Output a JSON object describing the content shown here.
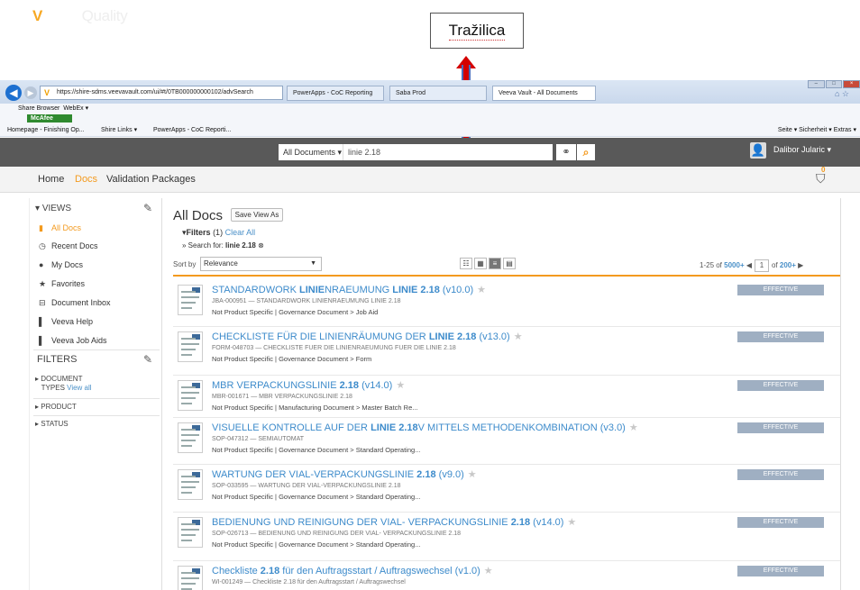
{
  "annotation": {
    "label": "Tražilica"
  },
  "browser": {
    "address": "https://shire-sdms.veevavault.com/ui/#t/0TB000000000102/advSearch",
    "tabs": [
      "PowerApps - CoC Reporting",
      "Saba Prod",
      "Veeva Vault - All Documents"
    ],
    "toolbar": {
      "share": "Share Browser",
      "webex": "WebEx ▾",
      "mcafee": "McAfee"
    },
    "favorites": [
      "Homepage - Finishing Op...",
      "Shire Links ▾",
      "PowerApps - CoC Reporti..."
    ],
    "commands": "Seite ▾  Sicherheit ▾  Extras ▾"
  },
  "header": {
    "logo_brand": "Vault",
    "logo_product": "Quality",
    "doc_selector": "All Documents ▾",
    "search_value": "linie 2.18",
    "user": "Dalibor Jularic ▾"
  },
  "nav": {
    "home": "Home",
    "docs": "Docs",
    "validation": "Validation Packages",
    "cart_count": "0"
  },
  "sidebar": {
    "views_title": "VIEWS",
    "views": [
      {
        "label": "All Docs",
        "icon": "doc-icon"
      },
      {
        "label": "Recent Docs",
        "icon": "clock-icon"
      },
      {
        "label": "My Docs",
        "icon": "user-icon"
      },
      {
        "label": "Favorites",
        "icon": "star-icon"
      },
      {
        "label": "Document Inbox",
        "icon": "inbox-icon"
      },
      {
        "label": "Veeva Help",
        "icon": "bookmark-icon"
      },
      {
        "label": "Veeva Job Aids",
        "icon": "bookmark-icon"
      }
    ],
    "filters_title": "FILTERS",
    "doc_types_1": "DOCUMENT",
    "doc_types_2": "TYPES",
    "view_all": "View all",
    "product": "PRODUCT",
    "status": "STATUS"
  },
  "main": {
    "title": "All Docs",
    "save_view": "Save View As",
    "filters_label": "Filters",
    "filters_count": "(1)",
    "clear_all": "Clear All",
    "search_for_label": "Search for:",
    "search_for_value": "linie 2.18",
    "sort_label": "Sort by",
    "sort_value": "Relevance",
    "pager_range": "1-25 of",
    "pager_total": "5000+",
    "page": "1",
    "page_of": "of",
    "page_total": "200+"
  },
  "docs": [
    {
      "title_pre": "STANDARDWORK ",
      "title_b1": "LINIE",
      "title_mid": "NRAEUMUNG ",
      "title_b2": "LINIE 2.18",
      "title_post": " (v10.0)",
      "sub": "JBA-000951 — STANDARDWORK LINIENRAEUMUNG LINIE 2.18",
      "cat": "Not Product Specific  |  Governance Document > Job Aid",
      "status": "EFFECTIVE"
    },
    {
      "title_pre": "CHECKLISTE FÜR DIE LINIENRÄUMUNG DER ",
      "title_b1": "LINIE 2.18",
      "title_mid": "",
      "title_b2": "",
      "title_post": " (v13.0)",
      "sub": "FORM-048703 — CHECKLISTE FUER DIE LINIENRAEUMUNG FUER DIE LINIE 2.18",
      "cat": "Not Product Specific  |  Governance Document > Form",
      "status": "EFFECTIVE"
    },
    {
      "title_pre": "MBR VERPACKUNGSLINIE ",
      "title_b1": "2.18",
      "title_mid": "",
      "title_b2": "",
      "title_post": " (v14.0)",
      "sub": "MBR-001671 — MBR VERPACKUNGSLINIE 2.18",
      "cat": "Not Product Specific  |  Manufacturing Document > Master Batch Re...",
      "status": "EFFECTIVE"
    },
    {
      "title_pre": "VISUELLE KONTROLLE AUF DER ",
      "title_b1": "LINIE 2.18",
      "title_mid": "V MITTELS METHODENKOMBINATION",
      "title_b2": "",
      "title_post": " (v3.0)",
      "sub": "SOP-047312 — SEMIAUTOMAT",
      "cat": "Not Product Specific  |  Governance Document > Standard Operating...",
      "status": "EFFECTIVE"
    },
    {
      "title_pre": "WARTUNG DER VIAL-VERPACKUNGSLINIE ",
      "title_b1": "2.18",
      "title_mid": "",
      "title_b2": "",
      "title_post": " (v9.0)",
      "sub": "SOP-033595 — WARTUNG DER VIAL-VERPACKUNGSLINIE 2.18",
      "cat": "Not Product Specific  |  Governance Document > Standard Operating...",
      "status": "EFFECTIVE"
    },
    {
      "title_pre": "BEDIENUNG UND REINIGUNG DER VIAL- VERPACKUNGSLINIE ",
      "title_b1": "2.18",
      "title_mid": "",
      "title_b2": "",
      "title_post": " (v14.0)",
      "sub": "SOP-026713 — BEDIENUNG UND REINIGUNG DER VIAL- VERPACKUNGSLINIE 2.18",
      "cat": "Not Product Specific  |  Governance Document > Standard Operating...",
      "status": "EFFECTIVE"
    },
    {
      "title_pre": "Checkliste ",
      "title_b1": "2.18",
      "title_mid": " für den Auftragsstart / Auftragswechsel",
      "title_b2": "",
      "title_post": " (v1.0)",
      "sub": "WI-001249 — Checkliste 2.18 für den Auftragsstart / Auftragswechsel",
      "cat": "",
      "status": "EFFECTIVE"
    }
  ]
}
